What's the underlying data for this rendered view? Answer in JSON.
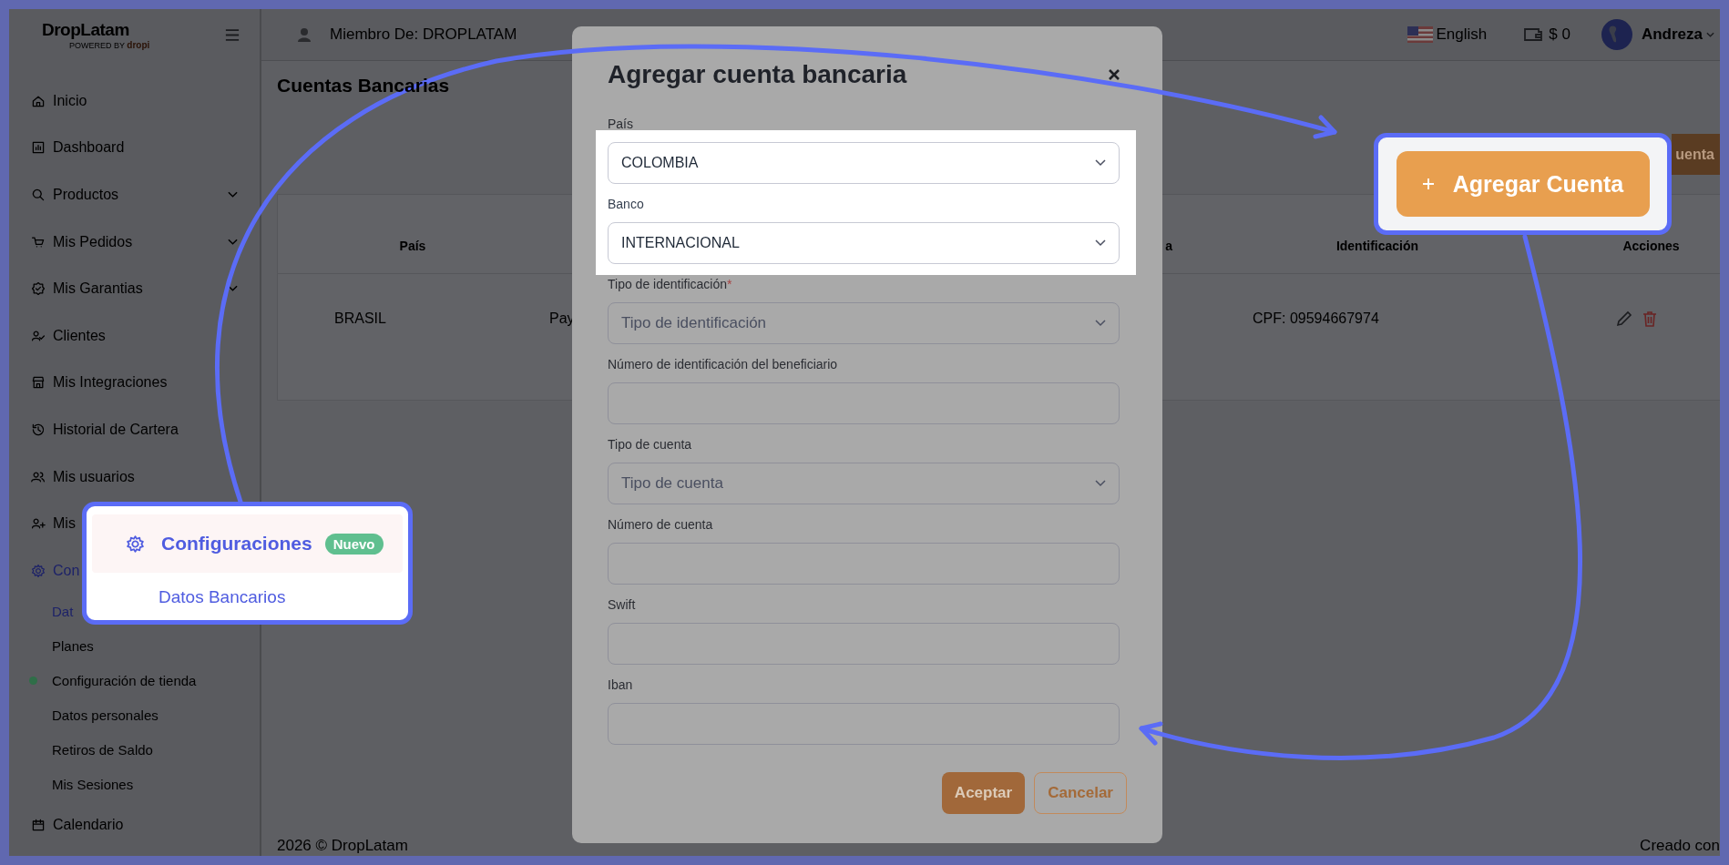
{
  "logo": {
    "name": "DropLatam",
    "tagline_prefix": "POWERED BY",
    "tagline_brand": "dropi"
  },
  "topbar": {
    "member": "Miembro De: DROPLATAM",
    "language": "English",
    "balance": "$ 0",
    "user": "Andreza"
  },
  "sidebar": {
    "items": [
      {
        "label": "Inicio",
        "expandable": false,
        "selected": false
      },
      {
        "label": "Dashboard",
        "expandable": false,
        "selected": false
      },
      {
        "label": "Productos",
        "expandable": true,
        "selected": false
      },
      {
        "label": "Mis Pedidos",
        "expandable": true,
        "selected": false
      },
      {
        "label": "Mis Garantias",
        "expandable": true,
        "selected": false
      },
      {
        "label": "Clientes",
        "expandable": false,
        "selected": false
      },
      {
        "label": "Mis Integraciones",
        "expandable": false,
        "selected": false
      },
      {
        "label": "Historial de Cartera",
        "expandable": false,
        "selected": false
      },
      {
        "label": "Mis usuarios",
        "expandable": false,
        "selected": false
      },
      {
        "label": "Mis",
        "expandable": false,
        "selected": false
      },
      {
        "label": "Con",
        "expandable": false,
        "selected": true,
        "children": [
          {
            "label": "Dat",
            "selected": true
          },
          {
            "label": "Planes",
            "selected": false
          },
          {
            "label": "Configuración de tienda",
            "selected": false,
            "color": "#2f6e48"
          },
          {
            "label": "Datos personales",
            "selected": false
          },
          {
            "label": "Retiros de Saldo",
            "selected": false
          },
          {
            "label": "Mis Sesiones",
            "selected": false
          }
        ]
      },
      {
        "label": "Calendario",
        "expandable": false,
        "selected": false
      }
    ]
  },
  "page": {
    "title": "Cuentas Bancarias",
    "add_button": "uenta",
    "table": {
      "columns": [
        "País",
        "a",
        "Identificación",
        "Acciones"
      ],
      "rows": [
        {
          "cells": [
            "BRASIL",
            "Pay",
            "CPF: 09594667974"
          ]
        }
      ]
    }
  },
  "footer": {
    "copyright": "2026 © DropLatam",
    "credit": "Creado con"
  },
  "modal": {
    "title": "Agregar cuenta bancaria",
    "fields": [
      {
        "kind": "select",
        "label": "País",
        "value": "COLOMBIA",
        "required": false,
        "highlighted": true
      },
      {
        "kind": "select",
        "label": "Banco",
        "value": "INTERNACIONAL",
        "required": false,
        "highlighted": true
      },
      {
        "kind": "select",
        "label": "Tipo de identificación",
        "required": true,
        "required_mark": "*",
        "placeholder": "Tipo de identificación",
        "highlighted": false
      },
      {
        "kind": "input",
        "label": "Número de identificación del beneficiario",
        "required": false,
        "highlighted": false
      },
      {
        "kind": "select",
        "label": "Tipo de cuenta",
        "placeholder": "Tipo de cuenta",
        "required": false,
        "highlighted": false
      },
      {
        "kind": "input",
        "label": "Número de cuenta",
        "required": false,
        "highlighted": false
      },
      {
        "kind": "input",
        "label": "Swift",
        "required": false,
        "highlighted": false
      },
      {
        "kind": "input",
        "label": "Iban",
        "required": false,
        "highlighted": false
      }
    ],
    "buttons": [
      {
        "kind": "primary",
        "label": "Aceptar"
      },
      {
        "kind": "secondary",
        "label": "Cancelar"
      }
    ]
  },
  "callouts": [
    {
      "kind": "button",
      "label": "Agregar Cuenta"
    },
    {
      "kind": "menu",
      "label": "Configuraciones",
      "badge": "Nuevo",
      "child": "Datos Bancarios"
    }
  ]
}
